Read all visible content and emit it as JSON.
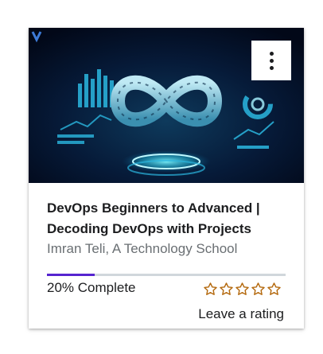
{
  "course": {
    "title": "DevOps Beginners to Advanced | Decoding DevOps with Projects",
    "instructor": "Imran Teli, A Technology School",
    "thumbnail_icon": "devops-infinity-icon",
    "badge_icon": "v-logo-icon"
  },
  "progress": {
    "percent": 20,
    "label": "20% Complete"
  },
  "rating": {
    "stars": 5,
    "filled": 0,
    "label": "Leave a rating",
    "star_color": "#b4690e"
  },
  "menu": {
    "icon": "more-vertical-icon"
  },
  "colors": {
    "progress_fill": "#5624d0",
    "progress_track": "#d1d7dc",
    "text": "#1c1d1f",
    "muted": "#6a6f73"
  }
}
